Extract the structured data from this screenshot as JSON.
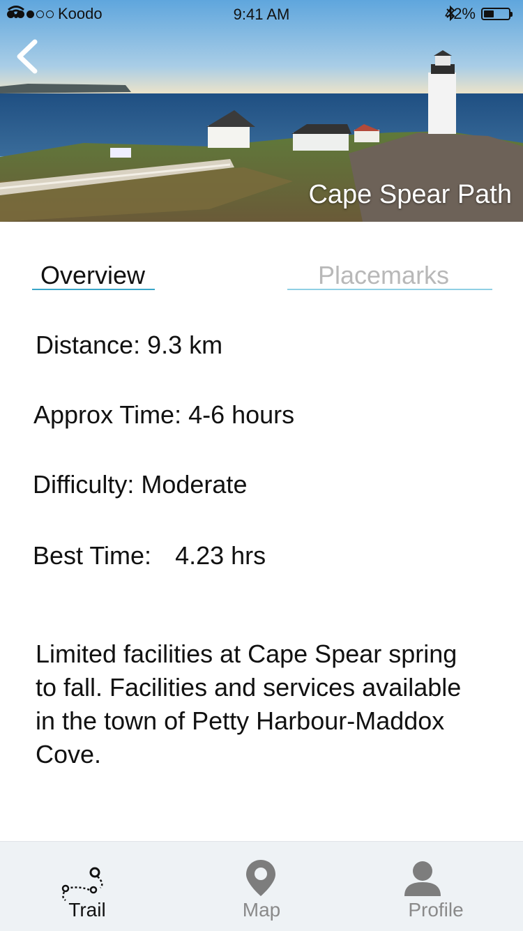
{
  "status_bar": {
    "carrier": "Koodo",
    "time": "9:41 AM",
    "battery": "42%",
    "battery_level": 0.42
  },
  "header": {
    "title": "Cape Spear Path",
    "back_icon": "chevron-left-icon"
  },
  "tabs": [
    {
      "label": "Overview",
      "active": true
    },
    {
      "label": "Placemarks",
      "active": false
    }
  ],
  "details": {
    "distance": "Distance: 9.3 km",
    "approx_time": "Approx Time: 4-6 hours",
    "difficulty": "Difficulty: Moderate",
    "best_time_label": "Best Time:",
    "best_time_value": "4.23 hrs"
  },
  "description": "Limited facilities at Cape Spear spring to fall. Facilities and services available in the town of Petty Harbour-Maddox Cove.",
  "tab_bar": [
    {
      "label": "Trail",
      "icon": "trail-icon",
      "active": true
    },
    {
      "label": "Map",
      "icon": "map-pin-icon",
      "active": false
    },
    {
      "label": "Profile",
      "icon": "profile-icon",
      "active": false
    }
  ],
  "colors": {
    "accent": "#3aa6c8",
    "inactive_text": "#b8b8b8",
    "tab_bar_bg": "#eef2f5"
  }
}
